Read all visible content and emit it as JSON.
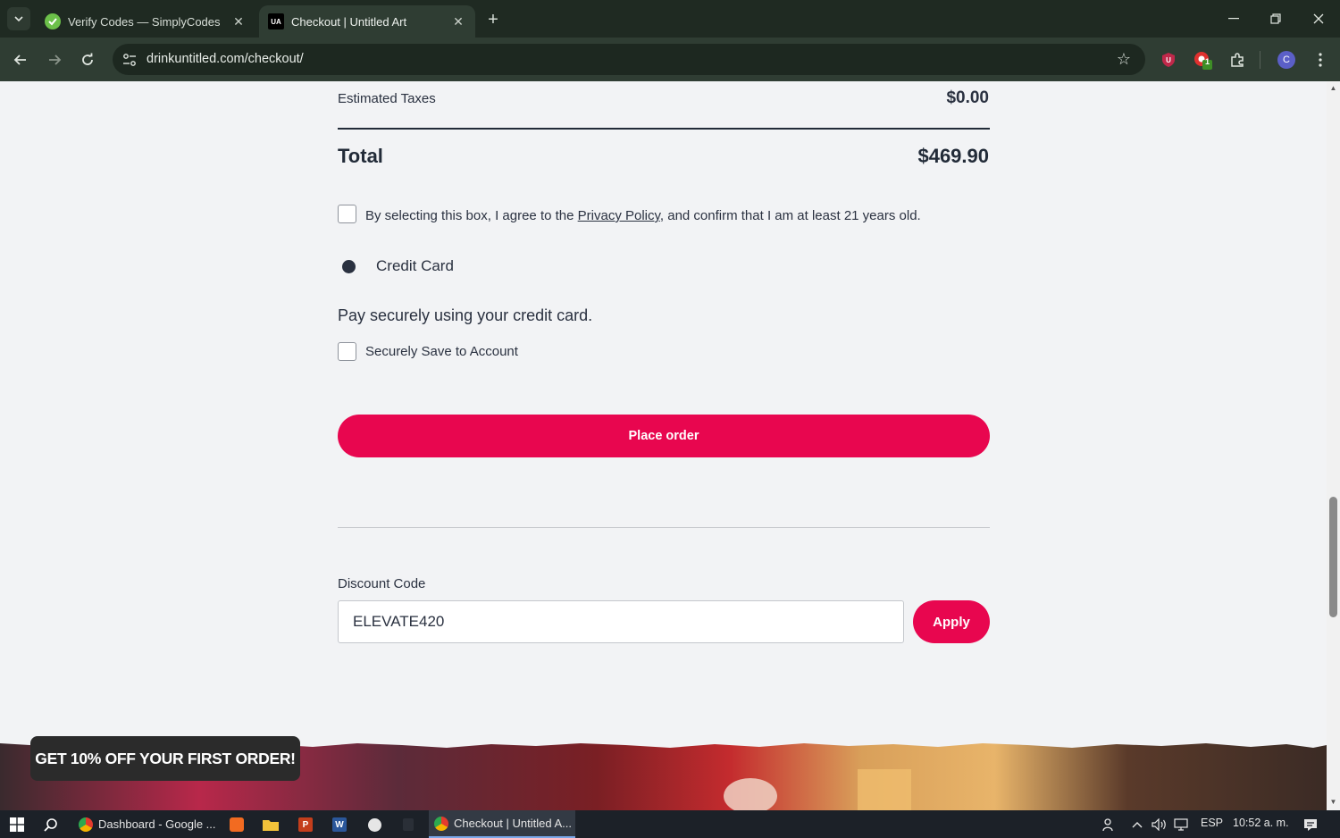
{
  "browser": {
    "tabs": [
      {
        "title": "Verify Codes — SimplyCodes",
        "active": false
      },
      {
        "title": "Checkout | Untitled Art",
        "active": true,
        "favicon_text": "UA"
      }
    ],
    "url": "drinkuntitled.com/checkout/",
    "profile_initial": "C",
    "extension_badge": "1"
  },
  "summary": {
    "taxes_label": "Estimated Taxes",
    "taxes_value": "$0.00",
    "total_label": "Total",
    "total_value": "$469.90"
  },
  "agreement": {
    "text_before": "By selecting this box, I agree to the ",
    "link": "Privacy Policy",
    "text_after": ", and confirm that I am at least 21 years old.",
    "checked": false
  },
  "payment": {
    "method_label": "Credit Card",
    "selected": true,
    "description": "Pay securely using your credit card.",
    "save_label": "Securely Save to Account",
    "save_checked": false
  },
  "place_order_label": "Place order",
  "discount": {
    "label": "Discount Code",
    "value": "ELEVATE420",
    "apply_label": "Apply"
  },
  "promo_label": "GET 10% OFF YOUR FIRST ORDER!",
  "colors": {
    "accent": "#e8064f",
    "text": "#2a3140",
    "page_bg": "#f2f3f5"
  },
  "taskbar": {
    "apps": [
      {
        "label": "Dashboard - Google ..."
      },
      {
        "label": "Checkout | Untitled A..."
      }
    ],
    "language": "ESP",
    "time": "10:52 a. m."
  }
}
